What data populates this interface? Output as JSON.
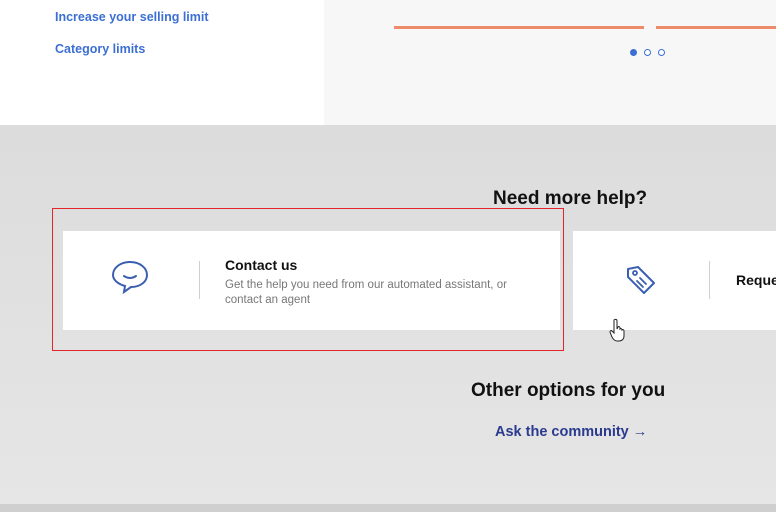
{
  "top_links": {
    "increase_limit": "Increase your selling limit",
    "category_limits": "Category limits"
  },
  "carousel": {
    "dots": 3,
    "active_index": 0
  },
  "help": {
    "heading": "Need more help?",
    "cards": [
      {
        "title": "Contact us",
        "description": "Get the help you need from our automated assistant, or contact an agent",
        "icon": "chat-bubble-icon"
      },
      {
        "title": "Reque",
        "icon": "price-tag-icon"
      }
    ]
  },
  "other": {
    "heading": "Other options for you",
    "community_link": "Ask the community",
    "community_arrow": "→"
  },
  "colors": {
    "link_blue": "#3b6fd4",
    "accent_orange": "#ee8b6a",
    "highlight_red": "#e2262b",
    "community_navy": "#2a3a8f"
  }
}
